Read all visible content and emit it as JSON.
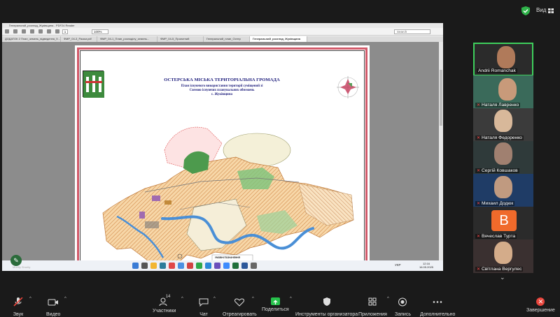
{
  "topbar": {
    "view_label": "Вид",
    "shield_icon": "shield-check-icon",
    "grid_icon": "grid-icon"
  },
  "viewer": {
    "title": "Генеральний_розгляд_Жуківщина - PDF24 Reader",
    "page_current": "1",
    "zoom": "100%",
    "search_placeholder": "Search",
    "tabs": [
      "ДОДАТОК 2 План_земель_відведення_9...",
      "ФМР_04-3_Разом.pdf",
      "ФМР_04-1_План_розподілу_земель...",
      "ФМР_04-5_Проектний",
      "Генеральний_план_Остер",
      "Генеральний_розгляд_Жуківщина"
    ]
  },
  "map": {
    "title": "ОСТЕРСЬКА МІСЬКА ТЕРИТОРІАЛЬНА ГРОМАДА",
    "subtitle_lines": [
      "План існуючого використання території суміщений зі",
      "Схемою існуючих планувальних обмежень",
      "с. Жуківщина"
    ],
    "legend_title": "УМОВНІ ПОЗНАЧЕННЯ"
  },
  "taskbar": {
    "lang": "УКР",
    "time": "12:16",
    "date": "16.05.2025"
  },
  "annotation_button": {
    "label": "Modify Shortly",
    "icon": "pencil-icon"
  },
  "participants": [
    {
      "name": "Andrii Romanchak",
      "muted": false,
      "active": true
    },
    {
      "name": "Наталя Лавренко",
      "muted": true,
      "active": false
    },
    {
      "name": "Наталя Федоренко",
      "muted": true,
      "active": false
    },
    {
      "name": "Сергій Ковшаков",
      "muted": true,
      "active": false
    },
    {
      "name": "Михаил Додюк",
      "muted": true,
      "active": false
    },
    {
      "name": "Вячеслав Турта",
      "muted": true,
      "active": false,
      "avatar_letter": "B"
    },
    {
      "name": "Світлана Вергулес",
      "muted": true,
      "active": false
    }
  ],
  "controls": {
    "audio": "Звук",
    "video": "Видео",
    "participants": "Участники",
    "participants_count": "14",
    "chat": "Чат",
    "react": "Отреагировать",
    "share": "Поделиться",
    "host_tools": "Инструменты организатора",
    "apps": "Приложения",
    "record": "Запись",
    "more": "Дополнительно",
    "end": "Завершение"
  },
  "colors": {
    "accent_green": "#3ecf5c",
    "share_green": "#27c24c",
    "end_red": "#e8453c",
    "map_orange": "#f2b27a",
    "map_river": "#4a8fd6"
  }
}
